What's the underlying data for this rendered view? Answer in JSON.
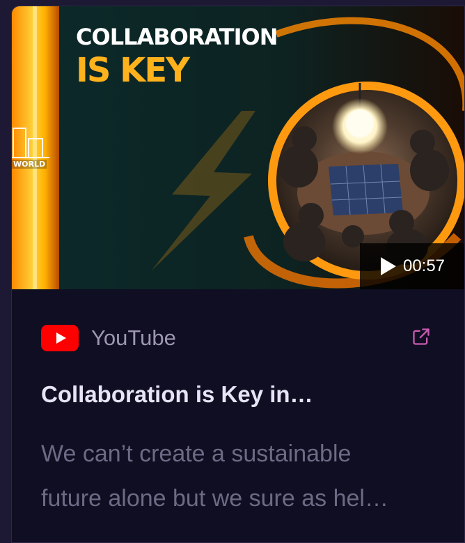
{
  "thumbnail": {
    "line1": "COLLABORATION",
    "line2": "IS KEY",
    "brand_text": "WORLD",
    "duration": "00:57",
    "play_icon": "play-icon"
  },
  "source": {
    "name": "YouTube",
    "icon": "youtube-icon",
    "external_icon": "external-link-icon",
    "brand_color": "#ff0000",
    "link_color": "#c75bb0"
  },
  "video": {
    "title": "Collaboration is Key in…",
    "description_line1": "We can’t create a sustainable",
    "description_line2": "future alone but we sure as hel…"
  }
}
